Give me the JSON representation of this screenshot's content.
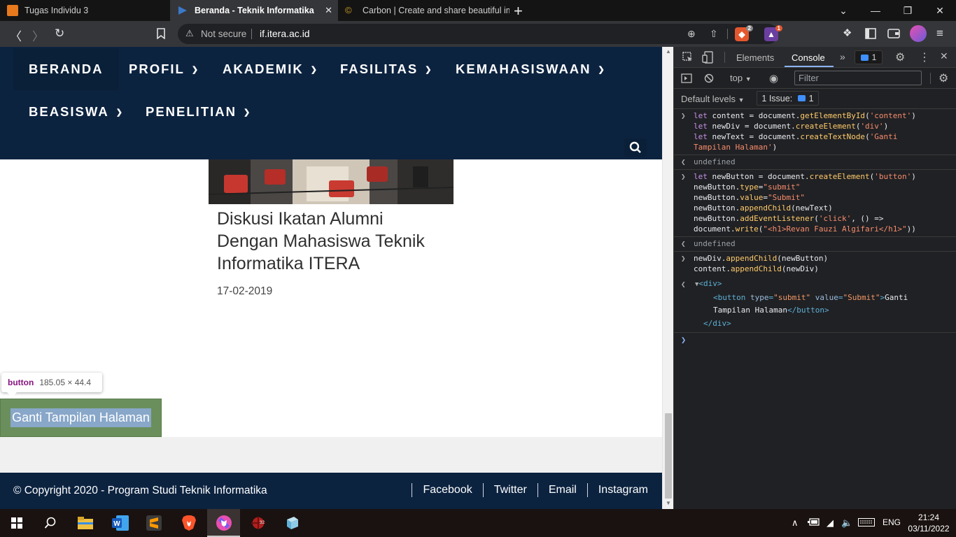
{
  "tabs": [
    {
      "title": "Tugas Individu 3",
      "active": false
    },
    {
      "title": "Beranda - Teknik Informatika",
      "active": true
    },
    {
      "title": "Carbon | Create and share beautiful im",
      "active": false
    }
  ],
  "tab_close_glyph": "✕",
  "new_tab_glyph": "+",
  "address": {
    "security_label": "Not secure",
    "url": "if.itera.ac.id"
  },
  "extensions": {
    "brave_shields_count": "2",
    "brave_rewards_count": "1"
  },
  "site": {
    "nav_row1": [
      "BERANDA",
      "PROFIL",
      "AKADEMIK",
      "FASILITAS",
      "KEMAHASISWAAN"
    ],
    "nav_row2": [
      "BEASISWA",
      "PENELITIAN"
    ],
    "post_title": "Diskusi Ikatan Alumni Dengan Mahasiswa Teknik Informatika ITERA",
    "post_date": "17-02-2019",
    "injected_button_label": "Ganti Tampilan Halaman",
    "inspect_tooltip": {
      "tag": "button",
      "dims": "185.05 × 44.4"
    },
    "footer": {
      "copyright": "© Copyright 2020 - Program Studi Teknik Informatika",
      "links": [
        "Facebook",
        "Twitter",
        "Email",
        "Instagram"
      ]
    }
  },
  "devtools": {
    "tabs": [
      "Elements",
      "Console"
    ],
    "active_tab": "Console",
    "issue_badge": "1",
    "context": "top",
    "filter_placeholder": "Filter",
    "levels": "Default levels",
    "issues_label": "1 Issue:",
    "issues_count": "1",
    "undefined_text": "undefined"
  },
  "taskbar": {
    "lang": "ENG",
    "time": "21:24",
    "date": "03/11/2022"
  },
  "colors": {
    "navy": "#0c2340",
    "devtools_bg": "#202124",
    "highlight": "#6b8f5c"
  }
}
